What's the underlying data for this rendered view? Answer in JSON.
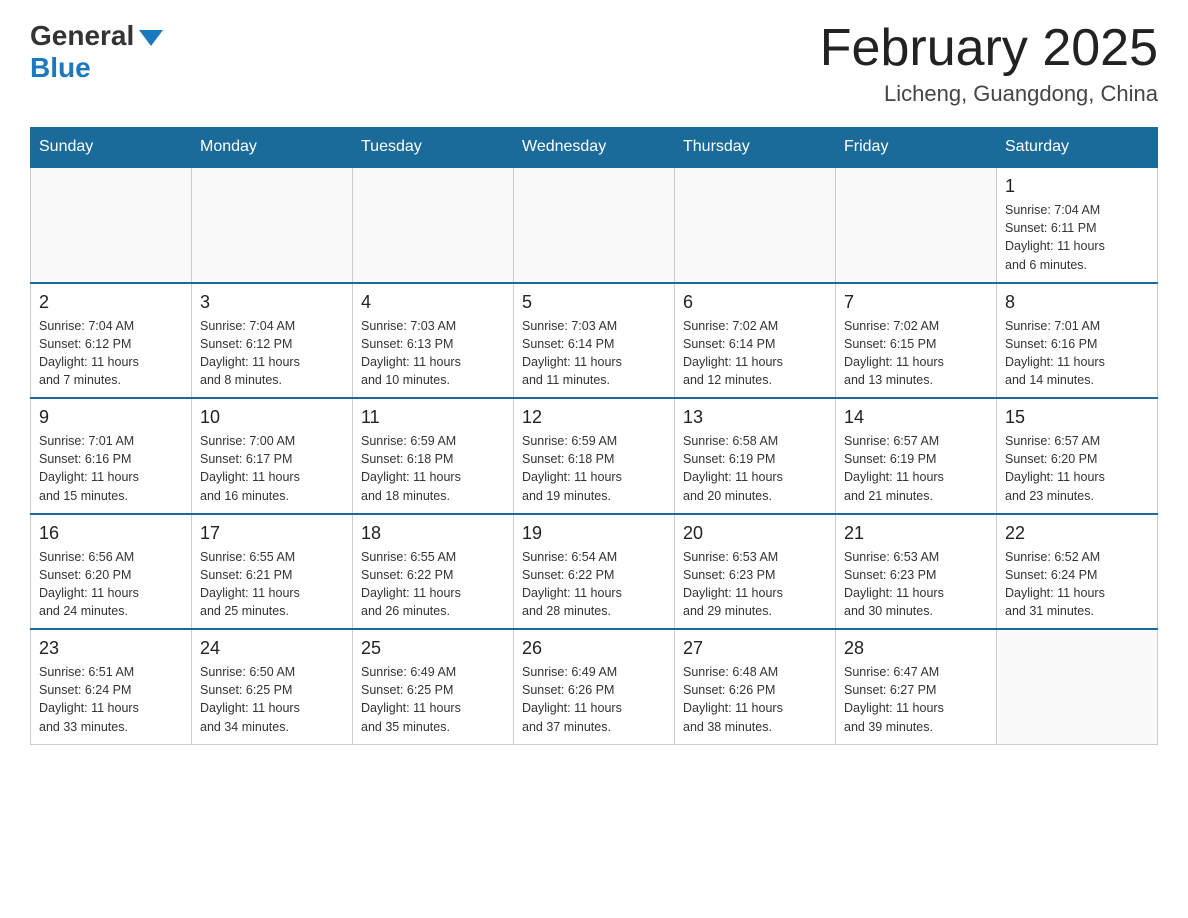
{
  "header": {
    "logo_general": "General",
    "logo_blue": "Blue",
    "month_title": "February 2025",
    "location": "Licheng, Guangdong, China"
  },
  "weekdays": [
    "Sunday",
    "Monday",
    "Tuesday",
    "Wednesday",
    "Thursday",
    "Friday",
    "Saturday"
  ],
  "weeks": [
    [
      {
        "day": "",
        "info": ""
      },
      {
        "day": "",
        "info": ""
      },
      {
        "day": "",
        "info": ""
      },
      {
        "day": "",
        "info": ""
      },
      {
        "day": "",
        "info": ""
      },
      {
        "day": "",
        "info": ""
      },
      {
        "day": "1",
        "info": "Sunrise: 7:04 AM\nSunset: 6:11 PM\nDaylight: 11 hours\nand 6 minutes."
      }
    ],
    [
      {
        "day": "2",
        "info": "Sunrise: 7:04 AM\nSunset: 6:12 PM\nDaylight: 11 hours\nand 7 minutes."
      },
      {
        "day": "3",
        "info": "Sunrise: 7:04 AM\nSunset: 6:12 PM\nDaylight: 11 hours\nand 8 minutes."
      },
      {
        "day": "4",
        "info": "Sunrise: 7:03 AM\nSunset: 6:13 PM\nDaylight: 11 hours\nand 10 minutes."
      },
      {
        "day": "5",
        "info": "Sunrise: 7:03 AM\nSunset: 6:14 PM\nDaylight: 11 hours\nand 11 minutes."
      },
      {
        "day": "6",
        "info": "Sunrise: 7:02 AM\nSunset: 6:14 PM\nDaylight: 11 hours\nand 12 minutes."
      },
      {
        "day": "7",
        "info": "Sunrise: 7:02 AM\nSunset: 6:15 PM\nDaylight: 11 hours\nand 13 minutes."
      },
      {
        "day": "8",
        "info": "Sunrise: 7:01 AM\nSunset: 6:16 PM\nDaylight: 11 hours\nand 14 minutes."
      }
    ],
    [
      {
        "day": "9",
        "info": "Sunrise: 7:01 AM\nSunset: 6:16 PM\nDaylight: 11 hours\nand 15 minutes."
      },
      {
        "day": "10",
        "info": "Sunrise: 7:00 AM\nSunset: 6:17 PM\nDaylight: 11 hours\nand 16 minutes."
      },
      {
        "day": "11",
        "info": "Sunrise: 6:59 AM\nSunset: 6:18 PM\nDaylight: 11 hours\nand 18 minutes."
      },
      {
        "day": "12",
        "info": "Sunrise: 6:59 AM\nSunset: 6:18 PM\nDaylight: 11 hours\nand 19 minutes."
      },
      {
        "day": "13",
        "info": "Sunrise: 6:58 AM\nSunset: 6:19 PM\nDaylight: 11 hours\nand 20 minutes."
      },
      {
        "day": "14",
        "info": "Sunrise: 6:57 AM\nSunset: 6:19 PM\nDaylight: 11 hours\nand 21 minutes."
      },
      {
        "day": "15",
        "info": "Sunrise: 6:57 AM\nSunset: 6:20 PM\nDaylight: 11 hours\nand 23 minutes."
      }
    ],
    [
      {
        "day": "16",
        "info": "Sunrise: 6:56 AM\nSunset: 6:20 PM\nDaylight: 11 hours\nand 24 minutes."
      },
      {
        "day": "17",
        "info": "Sunrise: 6:55 AM\nSunset: 6:21 PM\nDaylight: 11 hours\nand 25 minutes."
      },
      {
        "day": "18",
        "info": "Sunrise: 6:55 AM\nSunset: 6:22 PM\nDaylight: 11 hours\nand 26 minutes."
      },
      {
        "day": "19",
        "info": "Sunrise: 6:54 AM\nSunset: 6:22 PM\nDaylight: 11 hours\nand 28 minutes."
      },
      {
        "day": "20",
        "info": "Sunrise: 6:53 AM\nSunset: 6:23 PM\nDaylight: 11 hours\nand 29 minutes."
      },
      {
        "day": "21",
        "info": "Sunrise: 6:53 AM\nSunset: 6:23 PM\nDaylight: 11 hours\nand 30 minutes."
      },
      {
        "day": "22",
        "info": "Sunrise: 6:52 AM\nSunset: 6:24 PM\nDaylight: 11 hours\nand 31 minutes."
      }
    ],
    [
      {
        "day": "23",
        "info": "Sunrise: 6:51 AM\nSunset: 6:24 PM\nDaylight: 11 hours\nand 33 minutes."
      },
      {
        "day": "24",
        "info": "Sunrise: 6:50 AM\nSunset: 6:25 PM\nDaylight: 11 hours\nand 34 minutes."
      },
      {
        "day": "25",
        "info": "Sunrise: 6:49 AM\nSunset: 6:25 PM\nDaylight: 11 hours\nand 35 minutes."
      },
      {
        "day": "26",
        "info": "Sunrise: 6:49 AM\nSunset: 6:26 PM\nDaylight: 11 hours\nand 37 minutes."
      },
      {
        "day": "27",
        "info": "Sunrise: 6:48 AM\nSunset: 6:26 PM\nDaylight: 11 hours\nand 38 minutes."
      },
      {
        "day": "28",
        "info": "Sunrise: 6:47 AM\nSunset: 6:27 PM\nDaylight: 11 hours\nand 39 minutes."
      },
      {
        "day": "",
        "info": ""
      }
    ]
  ]
}
